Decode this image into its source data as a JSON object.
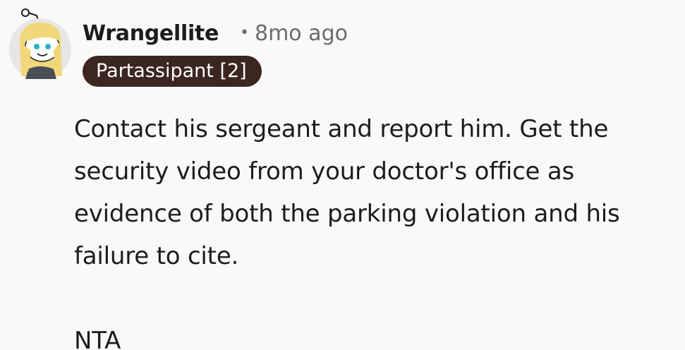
{
  "comment": {
    "author": "Wrangellite",
    "separator": "•",
    "timestamp": "8mo ago",
    "flair": "Partassipant [2]",
    "body_paragraphs": [
      "Contact his sergeant and report him. Get the security video from your doctor's office as evidence of both the parking violation and his failure to cite.",
      "NTA"
    ],
    "avatar_icon": "snoo-avatar-icon"
  },
  "colors": {
    "background": "#fbf9f8",
    "flair_bg": "#3b2620",
    "flair_text": "#ffffff",
    "meta_text": "#6b6b6b",
    "body_text": "#1c1c1c"
  }
}
